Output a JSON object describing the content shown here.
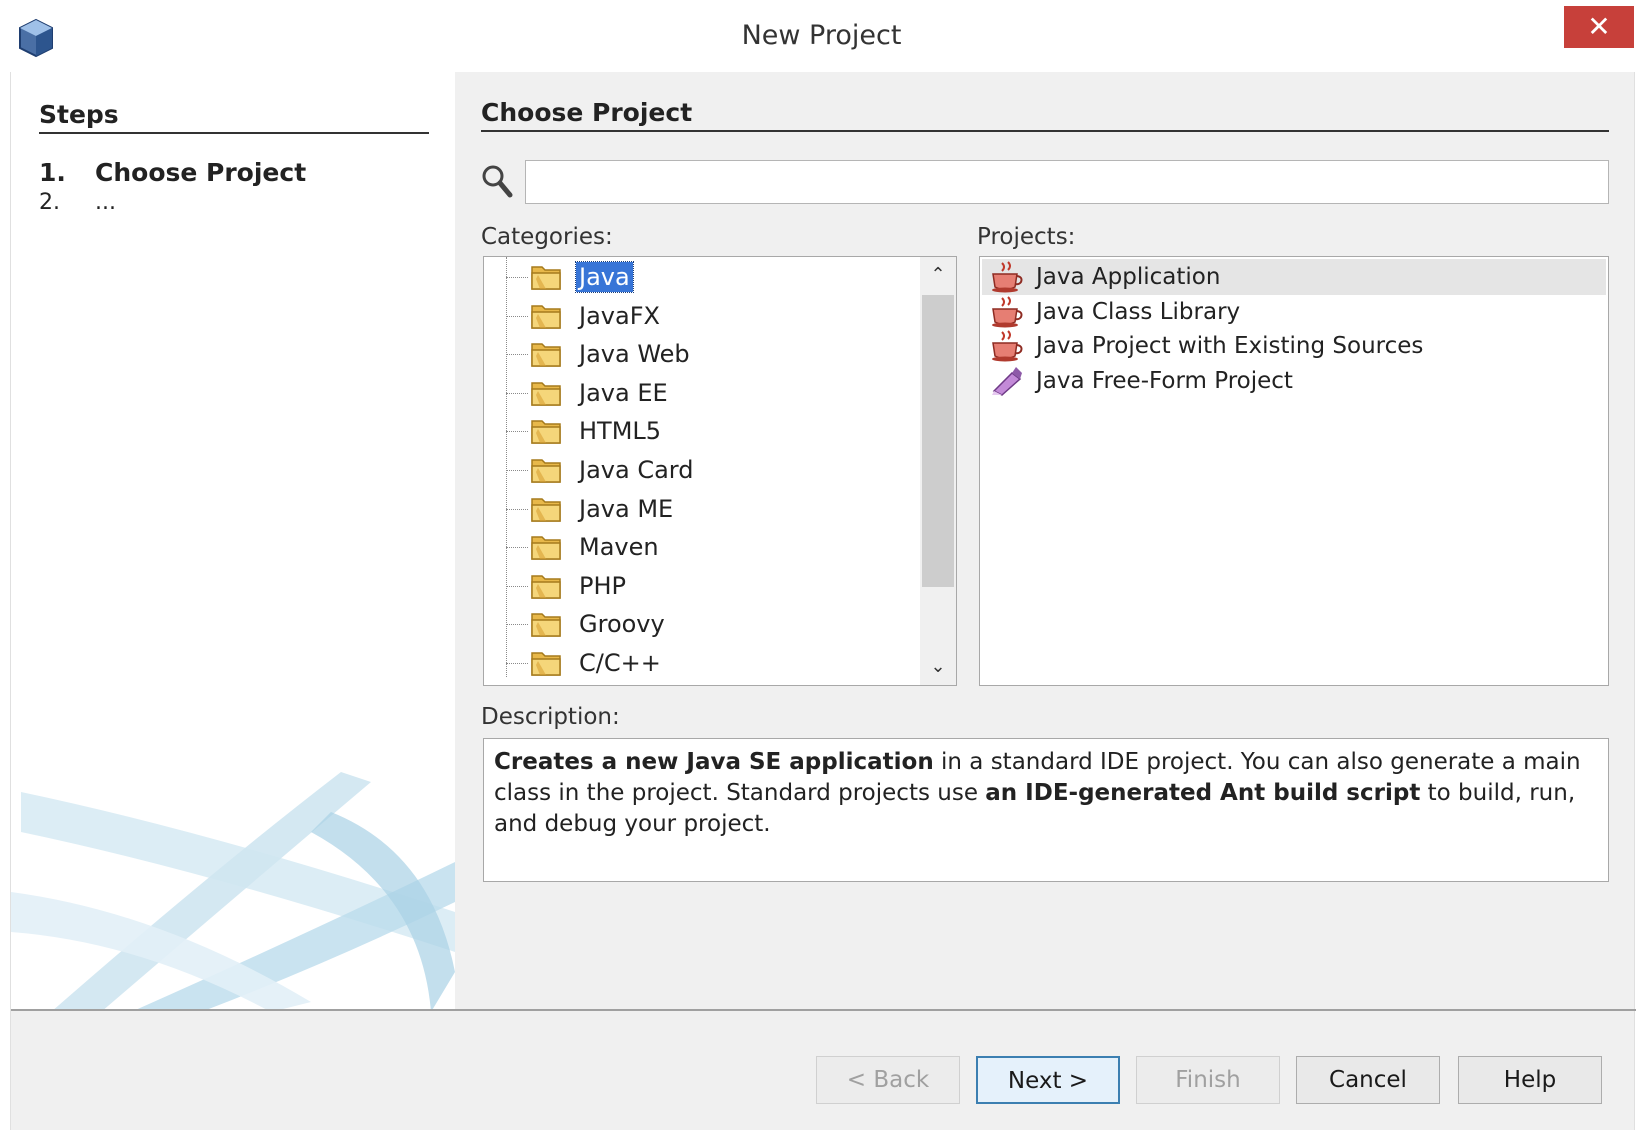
{
  "window": {
    "title": "New Project",
    "close_label": "✕"
  },
  "steps": {
    "title": "Steps",
    "items": [
      {
        "num": "1.",
        "label": "Choose Project"
      },
      {
        "num": "2.",
        "label": "..."
      }
    ]
  },
  "main": {
    "title": "Choose Project",
    "search": {
      "value": "",
      "placeholder": ""
    },
    "categories_label": "Categories:",
    "projects_label": "Projects:",
    "categories": [
      "Java",
      "JavaFX",
      "Java Web",
      "Java EE",
      "HTML5",
      "Java Card",
      "Java ME",
      "Maven",
      "PHP",
      "Groovy",
      "C/C++"
    ],
    "selected_category": "Java",
    "projects": [
      "Java Application",
      "Java Class Library",
      "Java Project with Existing Sources",
      "Java Free-Form Project"
    ],
    "selected_project": "Java Application",
    "description_label": "Description:",
    "description": {
      "bold1": "Creates a new Java SE application",
      "text1": " in a standard IDE project. You can also generate a main class in the project. Standard projects use ",
      "bold2": "an IDE-generated Ant build script",
      "text2": " to build, run, and debug your project."
    }
  },
  "buttons": {
    "back": "< Back",
    "next": "Next >",
    "finish": "Finish",
    "cancel": "Cancel",
    "help": "Help"
  },
  "colors": {
    "selection": "#3875d7",
    "close": "#c7403a",
    "default_button_border": "#3c7fb1"
  },
  "scroll": {
    "up_glyph": "⌃",
    "down_glyph": "⌄"
  }
}
